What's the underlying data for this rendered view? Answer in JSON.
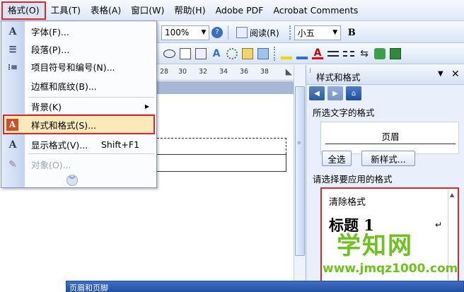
{
  "menubar": {
    "items": [
      "格式(O)",
      "工具(T)",
      "表格(A)",
      "窗口(W)",
      "帮助(H)",
      "Adobe PDF",
      "Acrobat Comments"
    ],
    "active": "格式(O)"
  },
  "toolbar1": {
    "zoom": "100%",
    "read_label": "阅读(R)",
    "font_size": "小五",
    "bold": "B"
  },
  "ruler": {
    "ticks": [
      "28",
      "30",
      "32",
      "34",
      "36",
      "38"
    ]
  },
  "format_menu": {
    "items": [
      {
        "label": "字体(F)...",
        "icon": "font-A-icon"
      },
      {
        "label": "段落(P)...",
        "icon": "paragraph-icon"
      },
      {
        "label": "项目符号和编号(N)...",
        "icon": "bullets-icon"
      },
      {
        "label": "边框和底纹(B)...",
        "icon": ""
      },
      {
        "label": "背景(K)",
        "icon": "",
        "submenu": true
      },
      {
        "label": "样式和格式(S)...",
        "icon": "styles-icon",
        "highlighted": true
      },
      {
        "label": "显示格式(V)...",
        "shortcut": "Shift+F1",
        "icon": "reveal-format-icon"
      },
      {
        "label": "对象(O)...",
        "icon": "object-icon",
        "disabled": true
      }
    ]
  },
  "task_pane": {
    "title": "样式和格式",
    "selected_text_label": "所选文字的格式",
    "current_format": "页眉",
    "select_all": "全选",
    "new_style": "新样式...",
    "apply_label": "请选择要应用的格式",
    "styles": [
      "清除格式",
      "标题 1"
    ]
  },
  "dialog_strip": {
    "title": "页眉和页脚"
  },
  "watermark": {
    "title": "学知网",
    "url": "www.jmqz1000.com"
  },
  "colors": {
    "highlight_border": "#d6282e",
    "highlight_fill": "#fbe9b8",
    "watermark": "#6dc21d"
  }
}
